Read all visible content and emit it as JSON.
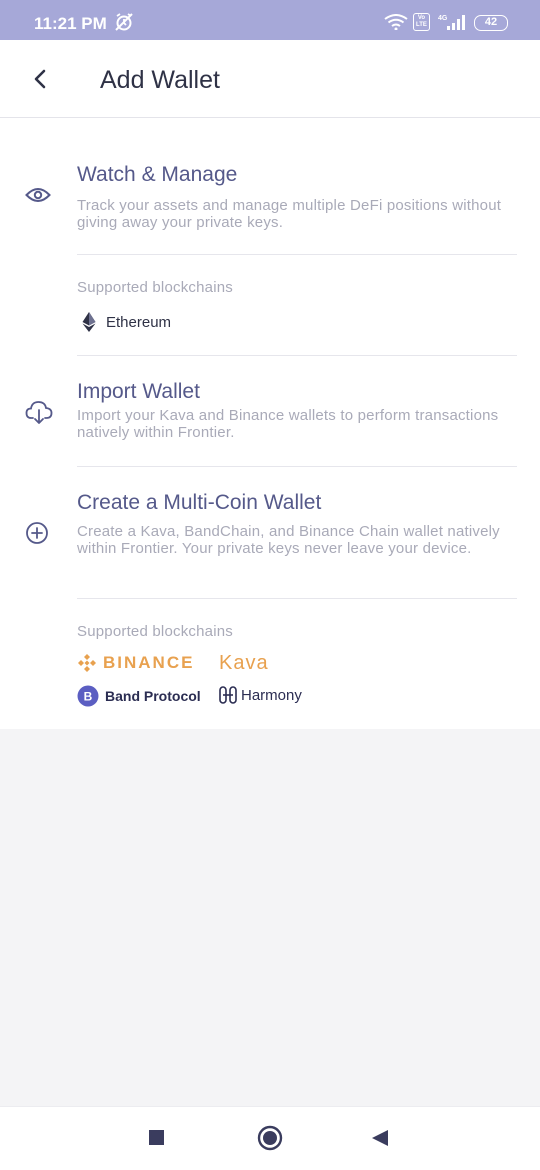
{
  "status_bar": {
    "time": "11:21 PM",
    "volte_badge": "Vo\nLTE",
    "network": "4G",
    "battery": "42"
  },
  "header": {
    "title": "Add Wallet",
    "back_icon": "chevron-left-icon"
  },
  "options": [
    {
      "icon": "eye-icon",
      "title": "Watch & Manage",
      "description": "Track your assets and manage multiple DeFi positions without giving away your private keys."
    },
    {
      "icon": "cloud-download-icon",
      "title": "Import Wallet",
      "description": "Import your Kava and Binance wallets to perform transactions natively within Frontier."
    },
    {
      "icon": "plus-circle-icon",
      "title": "Create a Multi-Coin Wallet",
      "description": "Create a Kava, BandChain, and Binance Chain wallet natively within Frontier. Your private keys never leave your device."
    }
  ],
  "watch_blockchains": {
    "label": "Supported blockchains",
    "chains": [
      "Ethereum"
    ]
  },
  "create_blockchains": {
    "label": "Supported blockchains",
    "chains": [
      "BINANCE",
      "Kava",
      "Band Protocol",
      "Harmony"
    ]
  },
  "colors": {
    "status_bar": "#a6a8d8",
    "title_accent": "#55598a",
    "muted_text": "#a9aab8",
    "binance_kava": "#e8a14f",
    "band_harmony": "#2b2d52"
  },
  "nav": {
    "recents_icon": "square-icon",
    "home_icon": "circle-home-icon",
    "back_icon": "triangle-back-icon"
  }
}
